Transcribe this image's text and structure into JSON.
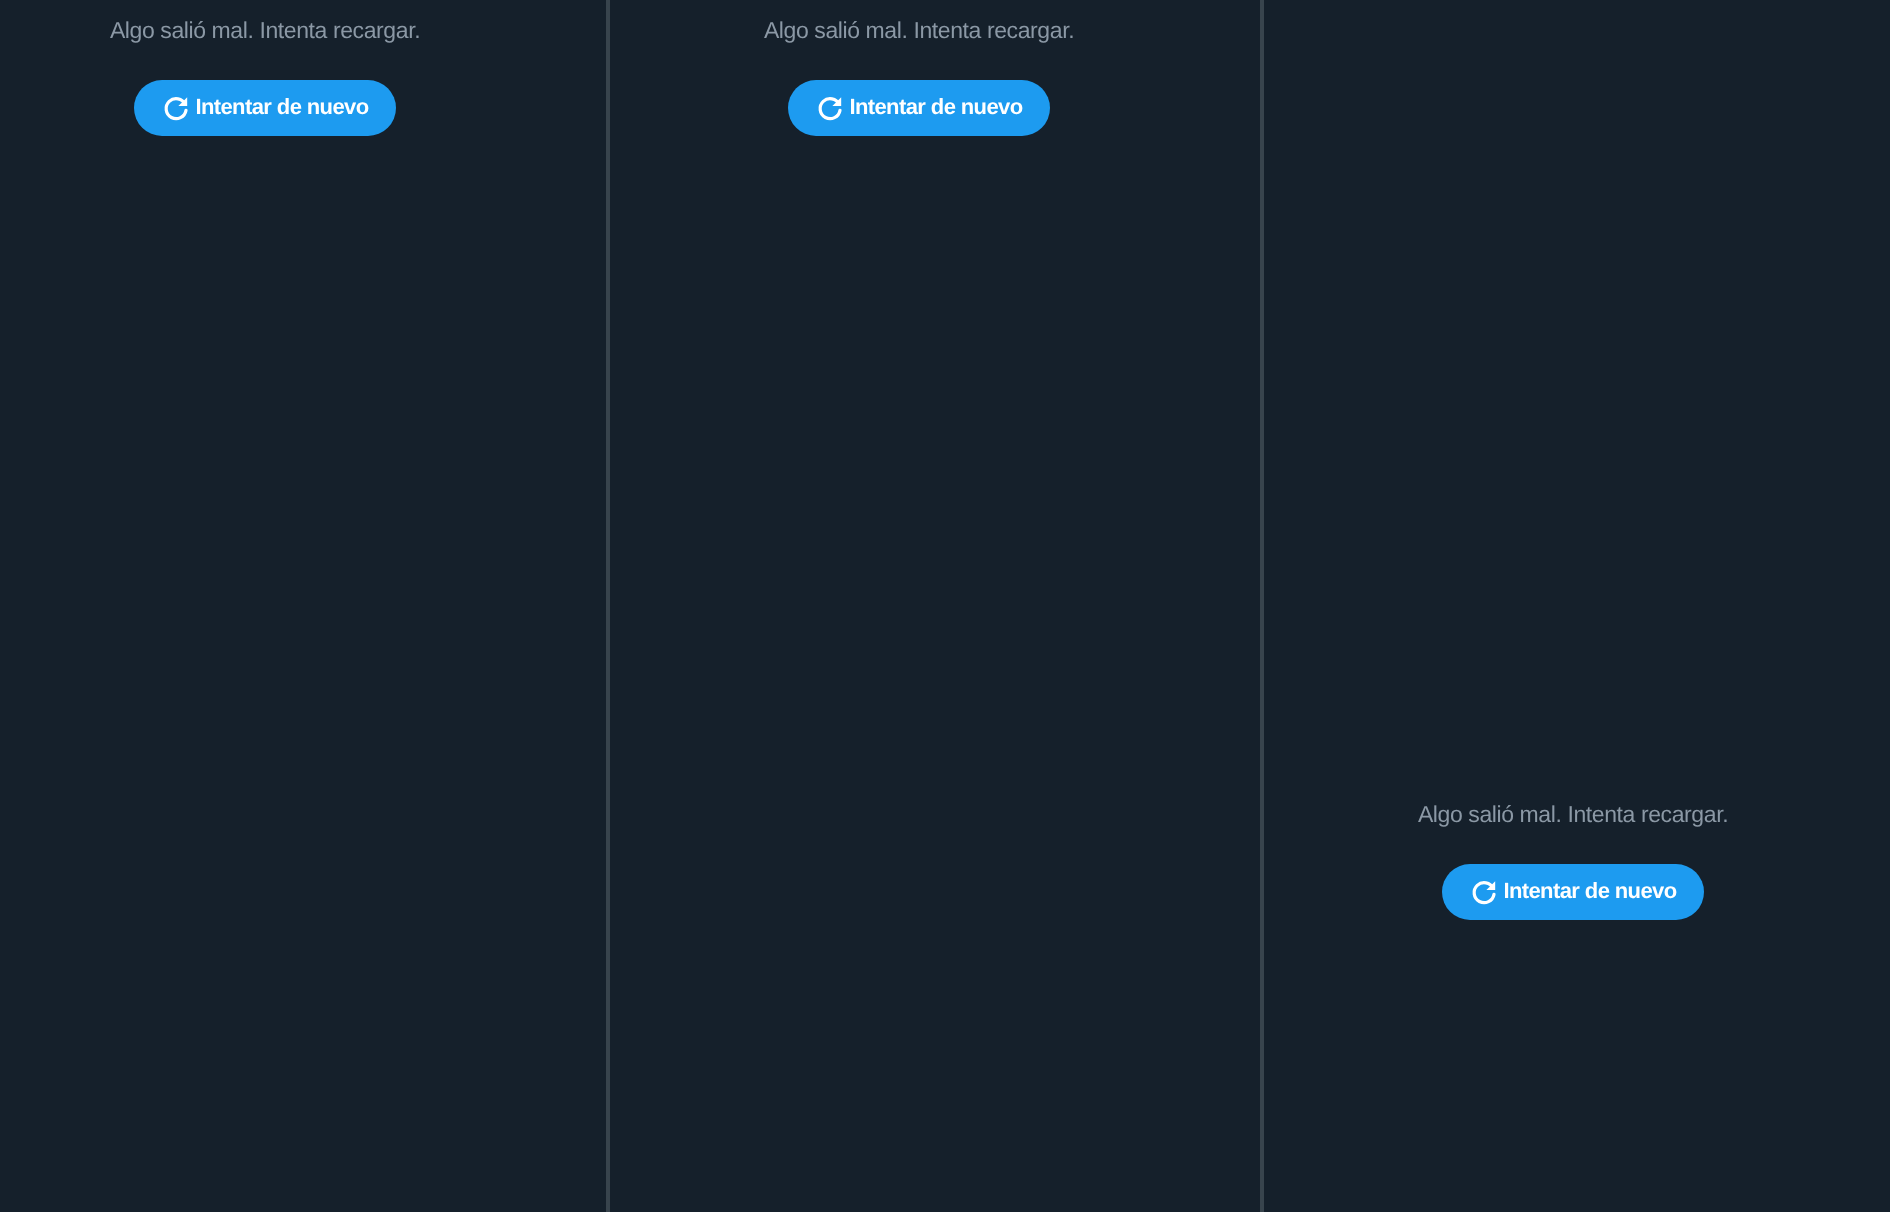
{
  "columns": [
    {
      "message": "Algo salió mal. Intenta recargar.",
      "retry_button": {
        "label": "Intentar de nuevo"
      }
    },
    {
      "message": "Algo salió mal. Intenta recargar.",
      "retry_button": {
        "label": "Intentar de nuevo"
      }
    },
    {
      "message": "Algo salió mal. Intenta recargar.",
      "retry_button": {
        "label": "Intentar de nuevo"
      }
    }
  ]
}
